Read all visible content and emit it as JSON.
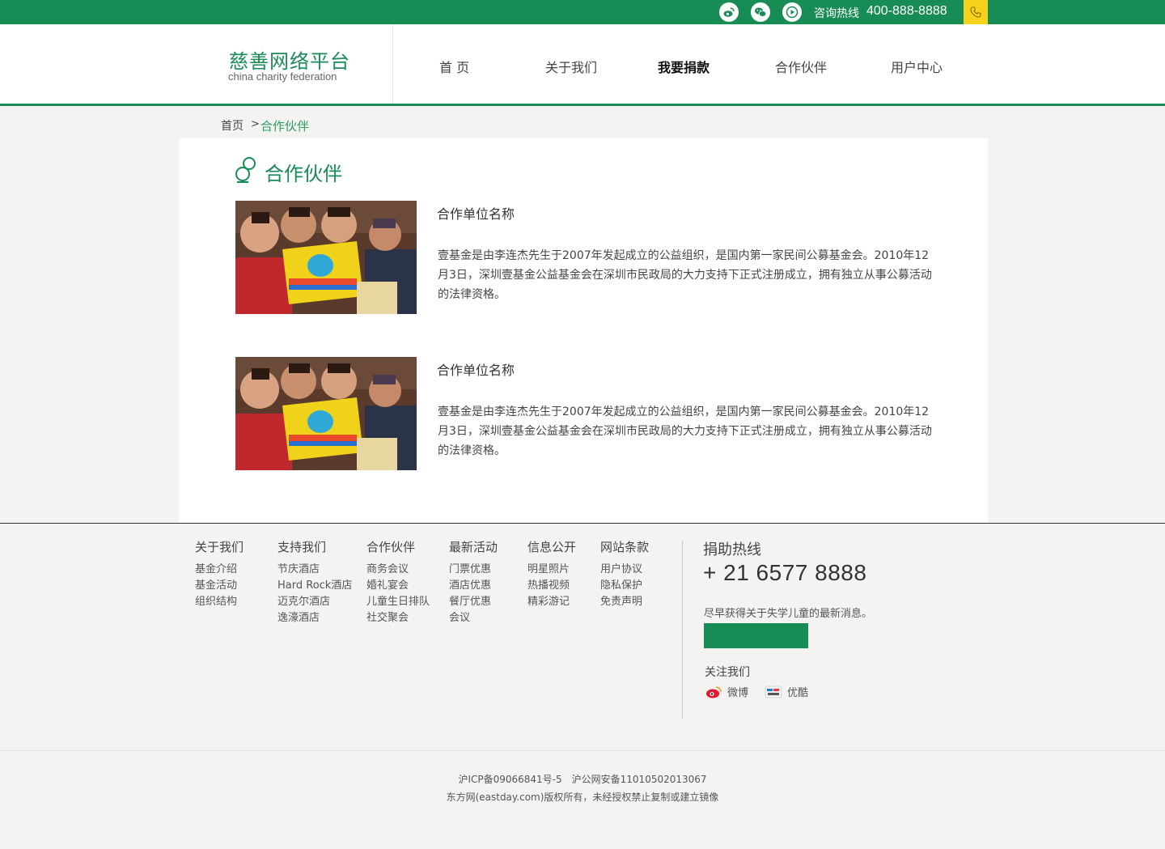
{
  "topbar": {
    "icons": [
      "weibo-icon",
      "wechat-icon",
      "play-icon",
      "phone-icon"
    ],
    "hotline_label": "咨询热线",
    "hotline_number": "400-888-8888"
  },
  "header": {
    "logo_cn": "慈善网络平台",
    "logo_en": "china charity federation",
    "nav": [
      "首 页",
      "关于我们",
      "我要捐款",
      "合作伙伴",
      "用户中心"
    ],
    "active_nav": "我要捐款"
  },
  "breadcrumb": {
    "home": "首页",
    "separator": ">",
    "current": "合作伙伴"
  },
  "section": {
    "title": "合作伙伴"
  },
  "partners": [
    {
      "name": "合作单位名称",
      "desc": "壹基金是由李连杰先生于2007年发起成立的公益组织，是国内第一家民间公募基金会。2010年12月3日，深圳壹基金公益基金会在深圳市民政局的大力支持下正式注册成立，拥有独立从事公募活动的法律资格。"
    },
    {
      "name": "合作单位名称",
      "desc": "壹基金是由李连杰先生于2007年发起成立的公益组织，是国内第一家民间公募基金会。2010年12月3日，深圳壹基金公益基金会在深圳市民政局的大力支持下正式注册成立，拥有独立从事公募活动的法律资格。"
    }
  ],
  "footer": {
    "columns": [
      {
        "title": "关于我们",
        "links": [
          "基金介绍",
          "基金活动",
          "组织结构"
        ]
      },
      {
        "title": "支持我们",
        "links": [
          "节庆酒店",
          "Hard Rock酒店",
          "迈克尔酒店",
          "逸濠酒店"
        ]
      },
      {
        "title": "合作伙伴",
        "links": [
          "商务会议",
          "婚礼宴会",
          "儿童生日排队",
          "社交聚会"
        ]
      },
      {
        "title": "最新活动",
        "links": [
          "门票优惠",
          "酒店优惠",
          "餐厅优惠",
          "会议"
        ]
      },
      {
        "title": "信息公开",
        "links": [
          "明星照片",
          "热播视频",
          "精彩游记"
        ]
      },
      {
        "title": "网站条款",
        "links": [
          "用户协议",
          "隐私保护",
          "免责声明"
        ]
      }
    ],
    "donate_title": "捐助热线",
    "donate_number": "+ 21 6577 8888",
    "newsletter_text": "尽早获得关于失学儿童的最新消息。",
    "follow_title": "关注我们",
    "sns": [
      {
        "icon": "weibo-icon",
        "label": "微博"
      },
      {
        "icon": "youku-icon",
        "label": "优酷"
      }
    ],
    "icp": "沪ICP备09066841号-5　沪公网安备11010502013067",
    "copyright": "东方网(eastday.com)版权所有，未经授权禁止复制或建立镜像"
  },
  "colors": {
    "brand_green": "#188c55",
    "accent_yellow": "#f7d21c",
    "page_bg": "#f4f3f1"
  }
}
